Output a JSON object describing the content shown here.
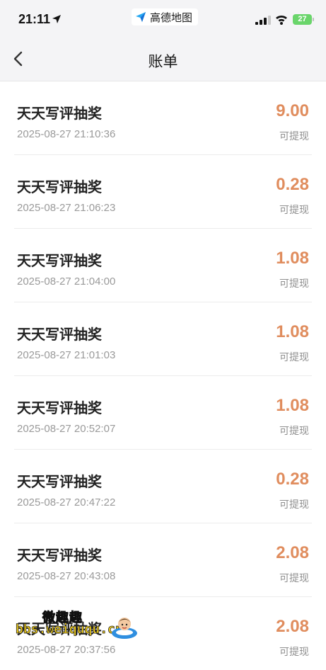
{
  "status_bar": {
    "time": "21:11",
    "app_name": "高德地图",
    "battery": "27"
  },
  "nav": {
    "title": "账单"
  },
  "bills": [
    {
      "title": "天天写评抽奖",
      "time": "2025-08-27 21:10:36",
      "amount": "9.00",
      "status": "可提现"
    },
    {
      "title": "天天写评抽奖",
      "time": "2025-08-27 21:06:23",
      "amount": "0.28",
      "status": "可提现"
    },
    {
      "title": "天天写评抽奖",
      "time": "2025-08-27 21:04:00",
      "amount": "1.08",
      "status": "可提现"
    },
    {
      "title": "天天写评抽奖",
      "time": "2025-08-27 21:01:03",
      "amount": "1.08",
      "status": "可提现"
    },
    {
      "title": "天天写评抽奖",
      "time": "2025-08-27 20:52:07",
      "amount": "1.08",
      "status": "可提现"
    },
    {
      "title": "天天写评抽奖",
      "time": "2025-08-27 20:47:22",
      "amount": "0.28",
      "status": "可提现"
    },
    {
      "title": "天天写评抽奖",
      "time": "2025-08-27 20:43:08",
      "amount": "2.08",
      "status": "可提现"
    },
    {
      "title": "天天写评抽奖",
      "time": "2025-08-27 20:37:56",
      "amount": "2.08",
      "status": "可提现"
    }
  ],
  "watermark": {
    "top": "微趣趣",
    "url": "bbs.weiququ.cn"
  },
  "colors": {
    "amount": "#e08d5e",
    "header_bg": "#f4f4f6",
    "battery": "#6ad56b"
  }
}
